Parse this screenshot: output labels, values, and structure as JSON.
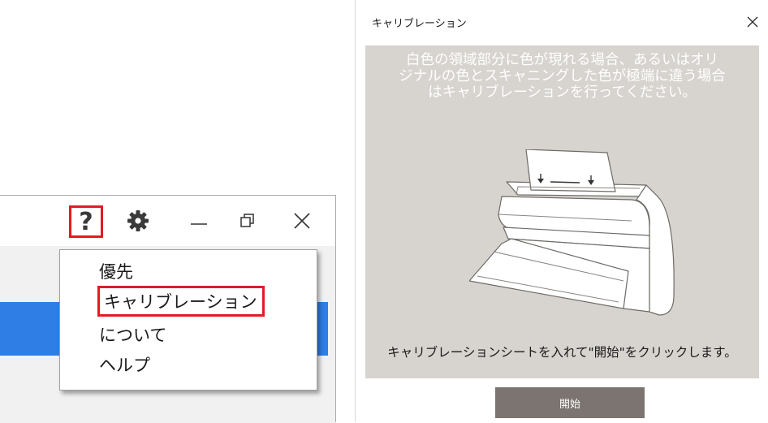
{
  "app_window": {
    "toolbar": {
      "help_icon": "?",
      "icons": [
        "question-mark-icon",
        "gear-icon",
        "minimize-icon",
        "restore-icon",
        "close-icon"
      ]
    },
    "menu": {
      "items": [
        {
          "label": "優先",
          "highlighted": false
        },
        {
          "label": "キャリブレーション",
          "highlighted": true
        },
        {
          "label": "について",
          "highlighted": false
        },
        {
          "label": "ヘルプ",
          "highlighted": false
        }
      ]
    }
  },
  "dialog": {
    "title": "キャリブレーション",
    "instruction": "白色の領域部分に色が現れる場合、あるいはオリ\nジナルの色とスキャニングした色が極端に違う場合\nはキャリブレーションを行ってください。",
    "footer_text": "キャリブレーションシートを入れて\"開始\"をクリックします。",
    "start_button": "開始"
  },
  "colors": {
    "highlight_red": "#e31b23",
    "selection_blue": "#2e7ee6",
    "panel_gray": "#d7d3cf",
    "button_gray": "#7b7470"
  }
}
